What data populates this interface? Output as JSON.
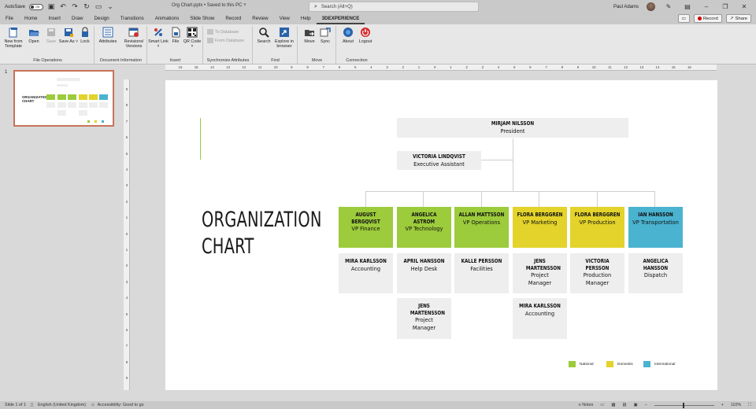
{
  "titlebar": {
    "autosave_label": "AutoSave",
    "autosave_state": "Off",
    "file_title": "Org Chart.pptx • Saved to this PC ˅",
    "search_placeholder": "Search (Alt+Q)",
    "user_name": "Paul Adams"
  },
  "tabs": [
    "File",
    "Home",
    "Insert",
    "Draw",
    "Design",
    "Transitions",
    "Animations",
    "Slide Show",
    "Record",
    "Review",
    "View",
    "Help",
    "3DEXPERIENCE"
  ],
  "active_tab": "3DEXPERIENCE",
  "ribbon_right": {
    "record": "Record",
    "share": "Share"
  },
  "ribbon": {
    "file_operations": {
      "label": "File Operations",
      "new_from_template": "New from Template",
      "open": "Open",
      "save": "Save",
      "save_as": "Save As ˅",
      "lock": "Lock"
    },
    "document_information": {
      "label": "Document Information",
      "attributes": "Attributes",
      "revisions": "Revisions/ Versions"
    },
    "insert": {
      "label": "Insert",
      "smart_link": "Smart Link ˅",
      "file": "File",
      "qr_code": "QR Code ˅"
    },
    "synchronize": {
      "label": "Synchronize Attributes",
      "to_database": "To Database",
      "from_database": "From Database"
    },
    "find": {
      "label": "Find",
      "search": "Search",
      "explore": "Explore in browser"
    },
    "move": {
      "label": "Move",
      "move": "Move",
      "sync": "Sync"
    },
    "connection": {
      "label": "Connection",
      "about": "About",
      "logout": "Logout"
    }
  },
  "thumbnail": {
    "number": "1",
    "title": "ORGANIZATION CHART"
  },
  "slide": {
    "title": "ORGANIZATION CHART",
    "president": {
      "name": "MIRJAM NILSSON",
      "role": "President"
    },
    "assistant": {
      "name": "VICTORIA LINDQVIST",
      "role": "Executive Assistant"
    },
    "vps": [
      {
        "name": "AUGUST BERGQVIST",
        "role": "VP Finance",
        "color": "#9ccb3b"
      },
      {
        "name": "ANGELICA ASTROM",
        "role": "VP Technology",
        "color": "#9ccb3b"
      },
      {
        "name": "ALLAN MATTSSON",
        "role": "VP Operations",
        "color": "#9ccb3b"
      },
      {
        "name": "FLORA BERGGREN",
        "role": "VP Marketing",
        "color": "#e3d32a"
      },
      {
        "name": "FLORA BERGGREN",
        "role": "VP Production",
        "color": "#e3d32a"
      },
      {
        "name": "IAN HANSSON",
        "role": "VP Transportation",
        "color": "#4ab3cf"
      }
    ],
    "reports": [
      [
        {
          "name": "MIRA KARLSSON",
          "role": "Accounting"
        }
      ],
      [
        {
          "name": "APRIL HANSSON",
          "role": "Help Desk"
        },
        {
          "name": "JENS MARTENSSON",
          "role": "Project Manager"
        }
      ],
      [
        {
          "name": "KALLE PERSSON",
          "role": "Facilities"
        }
      ],
      [
        {
          "name": "JENS MARTENSSON",
          "role": "Project Manager"
        },
        {
          "name": "MIRA KARLSSON",
          "role": "Accounting"
        }
      ],
      [
        {
          "name": "VICTORIA PERSSON",
          "role": "Production Manager"
        }
      ],
      [
        {
          "name": "ANGELICA HANSSON",
          "role": "Dispatch"
        }
      ]
    ],
    "legend": [
      {
        "label": "National",
        "color": "#9ccb3b"
      },
      {
        "label": "Domestic",
        "color": "#e3d32a"
      },
      {
        "label": "International",
        "color": "#4ab3cf"
      }
    ]
  },
  "status": {
    "slide_count": "Slide 1 of 1",
    "language": "English (United Kingdom)",
    "accessibility": "Accessibility: Good to go",
    "notes": "Notes",
    "zoom": "110%"
  },
  "colors": {
    "national": "#9ccb3b",
    "domestic": "#e3d32a",
    "international": "#4ab3cf",
    "accent": "#c8735a"
  }
}
